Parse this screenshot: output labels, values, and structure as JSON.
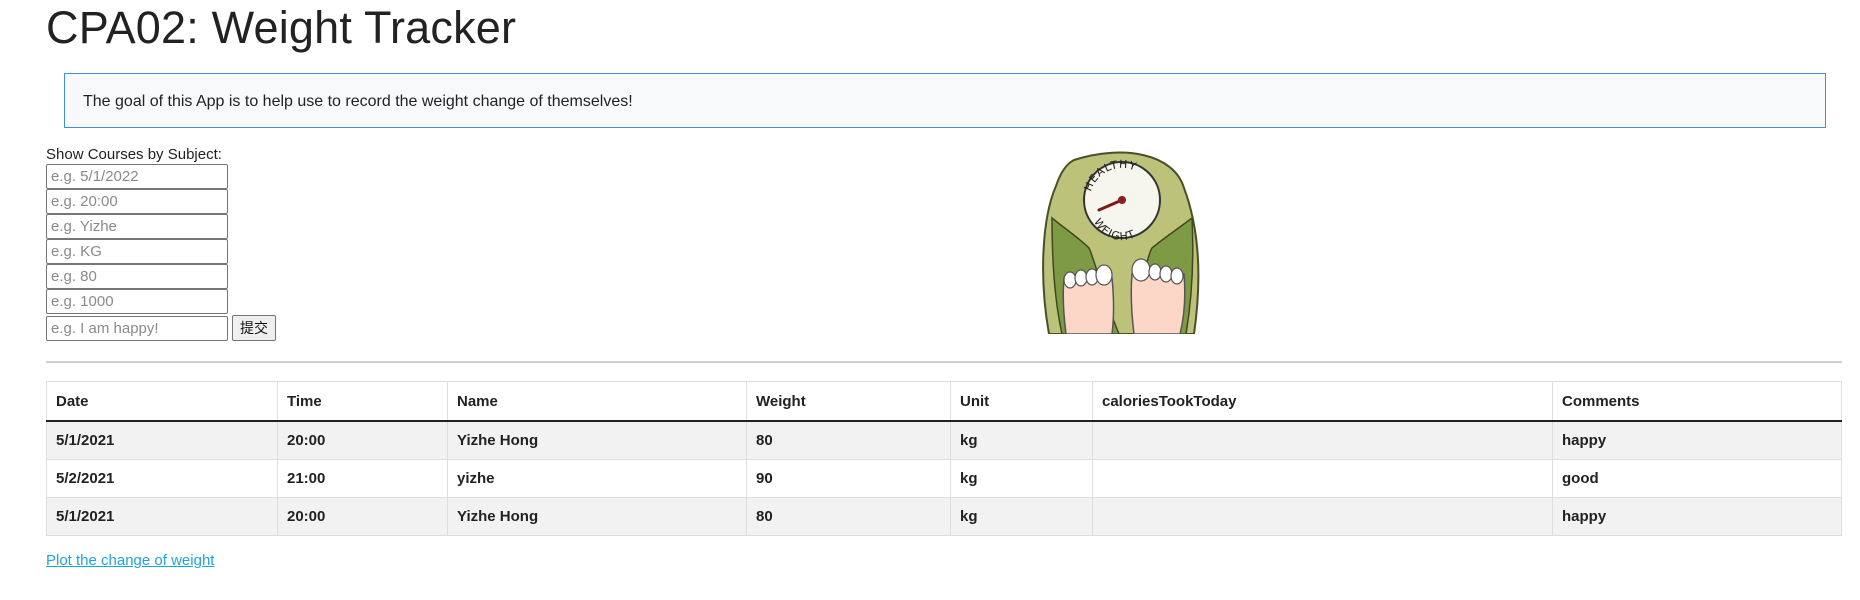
{
  "page": {
    "title": "CPA02: Weight Tracker",
    "goal": "The goal of this App is to help use to record the weight change of themselves!"
  },
  "form": {
    "label": "Show Courses by Subject:",
    "date_placeholder": "e.g. 5/1/2022",
    "time_placeholder": "e.g. 20:00",
    "name_placeholder": "e.g. Yizhe",
    "unit_placeholder": "e.g. KG",
    "weight_placeholder": "e.g. 80",
    "calories_placeholder": "e.g. 1000",
    "comments_placeholder": "e.g. I am happy!",
    "submit_label": "提交"
  },
  "illustration": {
    "dial_text_top": "HEALTHY",
    "dial_text_bottom": "WEIGHT",
    "icon": "bathroom-scale-icon"
  },
  "table": {
    "headers": [
      "Date",
      "Time",
      "Name",
      "Weight",
      "Unit",
      "caloriesTookToday",
      "Comments"
    ],
    "rows": [
      [
        "5/1/2021",
        "20:00",
        "Yizhe Hong",
        "80",
        "kg",
        "",
        "happy"
      ],
      [
        "5/2/2021",
        "21:00",
        "yizhe",
        "90",
        "kg",
        "",
        "good"
      ],
      [
        "5/1/2021",
        "20:00",
        "Yizhe Hong",
        "80",
        "kg",
        "",
        "happy"
      ]
    ]
  },
  "links": {
    "plot": "Plot the change of weight"
  },
  "colors": {
    "goal_border": "#3f8ee0",
    "link": "#1ea5dc",
    "scale_green": "#bcc27a",
    "scale_dark_green": "#7e9a45"
  }
}
